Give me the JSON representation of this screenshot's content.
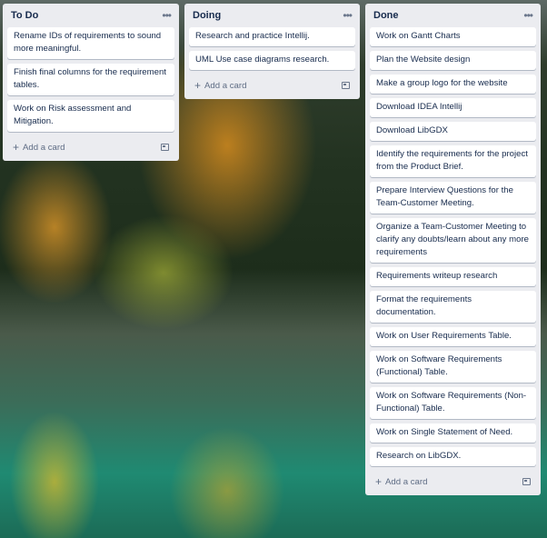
{
  "lists": [
    {
      "title": "To Do",
      "menu_icon": "ellipsis-icon",
      "cards": [
        "Rename IDs of requirements to sound more meaningful.",
        "Finish final columns for the requirement tables.",
        "Work on Risk assessment and Mitigation."
      ],
      "add_card_label": "Add a card"
    },
    {
      "title": "Doing",
      "menu_icon": "ellipsis-icon",
      "cards": [
        "Research and practice Intellij.",
        "UML Use case diagrams research."
      ],
      "add_card_label": "Add a card"
    },
    {
      "title": "Done",
      "menu_icon": "ellipsis-icon",
      "cards": [
        "Work on Gantt Charts",
        "Plan the Website design",
        "Make a group logo for the website",
        "Download IDEA Intellij",
        "Download LibGDX",
        "Identify the requirements for the project from the Product Brief.",
        "Prepare Interview Questions for the Team-Customer Meeting.",
        "Organize a Team-Customer Meeting to clarify any doubts/learn about any more requirements",
        "Requirements writeup research",
        "Format the requirements documentation.",
        "Work on User Requirements Table.",
        "Work on Software Requirements (Functional) Table.",
        "Work on Software Requirements (Non-Functional) Table.",
        "Work on Single Statement of Need.",
        "Research on LibGDX."
      ],
      "add_card_label": "Add a card"
    }
  ]
}
